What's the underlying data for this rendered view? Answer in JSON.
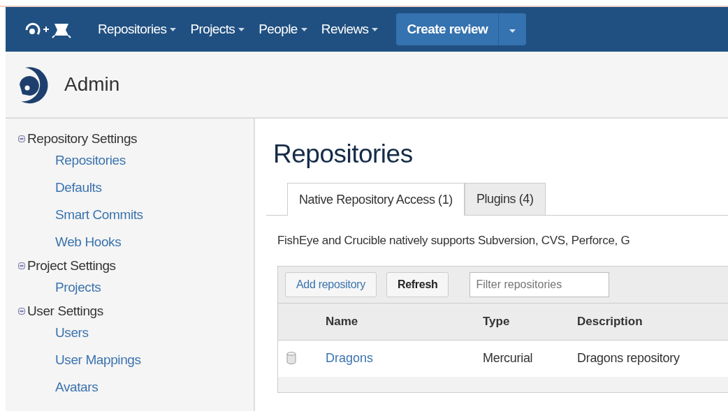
{
  "nav": {
    "items": [
      {
        "label": "Repositories"
      },
      {
        "label": "Projects"
      },
      {
        "label": "People"
      },
      {
        "label": "Reviews"
      }
    ],
    "create_button": "Create review"
  },
  "header": {
    "title": "Admin"
  },
  "sidebar": {
    "groups": [
      {
        "label": "Repository Settings",
        "expanded": true,
        "children": [
          "Repositories",
          "Defaults",
          "Smart Commits",
          "Web Hooks"
        ]
      },
      {
        "label": "Project Settings",
        "expanded": true,
        "children": [
          "Projects"
        ]
      },
      {
        "label": "User Settings",
        "expanded": true,
        "children": [
          "Users",
          "User Mappings",
          "Avatars"
        ]
      }
    ]
  },
  "content": {
    "title": "Repositories",
    "tabs": [
      {
        "label": "Native Repository Access (1)",
        "selected": true
      },
      {
        "label": "Plugins (4)",
        "selected": false
      }
    ],
    "description": "FishEye and Crucible natively supports Subversion, CVS, Perforce, G",
    "toolbar": {
      "add_button": "Add repository",
      "refresh_button": "Refresh",
      "filter": {
        "placeholder": "Filter repositories"
      }
    },
    "table": {
      "columns": [
        "Name",
        "Type",
        "Description"
      ],
      "rows": [
        {
          "name": "Dragons",
          "type": "Mercurial",
          "description": "Dragons repository"
        }
      ]
    }
  }
}
